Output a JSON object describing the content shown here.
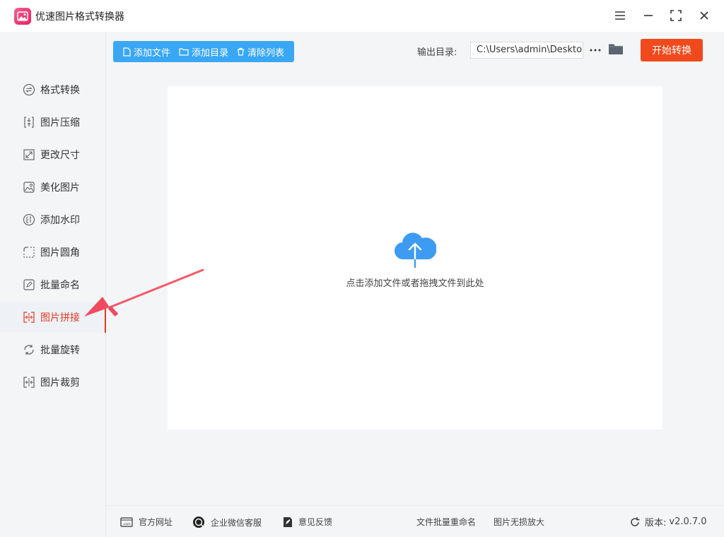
{
  "app": {
    "title": "优速图片格式转换器"
  },
  "sidebar": {
    "items": [
      {
        "label": "格式转换",
        "icon": "convert-icon"
      },
      {
        "label": "图片压缩",
        "icon": "compress-icon"
      },
      {
        "label": "更改尺寸",
        "icon": "resize-icon"
      },
      {
        "label": "美化图片",
        "icon": "beautify-icon"
      },
      {
        "label": "添加水印",
        "icon": "watermark-icon"
      },
      {
        "label": "图片圆角",
        "icon": "round-corner-icon"
      },
      {
        "label": "批量命名",
        "icon": "rename-icon"
      },
      {
        "label": "图片拼接",
        "icon": "stitch-icon",
        "active": true
      },
      {
        "label": "批量旋转",
        "icon": "rotate-icon"
      },
      {
        "label": "图片裁剪",
        "icon": "crop-icon"
      }
    ]
  },
  "toolbar": {
    "add_file": "添加文件",
    "add_folder": "添加目录",
    "clear_list": "清除列表",
    "output_label": "输出目录:",
    "output_path": "C:\\Users\\admin\\Desktop",
    "more": "···",
    "start": "开始转换"
  },
  "dropzone": {
    "hint": "点击添加文件或者拖拽文件到此处"
  },
  "footer": {
    "website": "官方网址",
    "wechat": "企业微信客服",
    "feedback": "意见反馈",
    "batch_rename": "文件批量重命名",
    "lossless_enlarge": "图片无损放大",
    "version_label": "版本:",
    "version": "v2.0.7.0"
  },
  "colors": {
    "accent": "#f04a1c",
    "toolbar_blue": "#3aa7f4",
    "active_red": "#e03b22",
    "cloud_blue": "#3d9bf2"
  }
}
